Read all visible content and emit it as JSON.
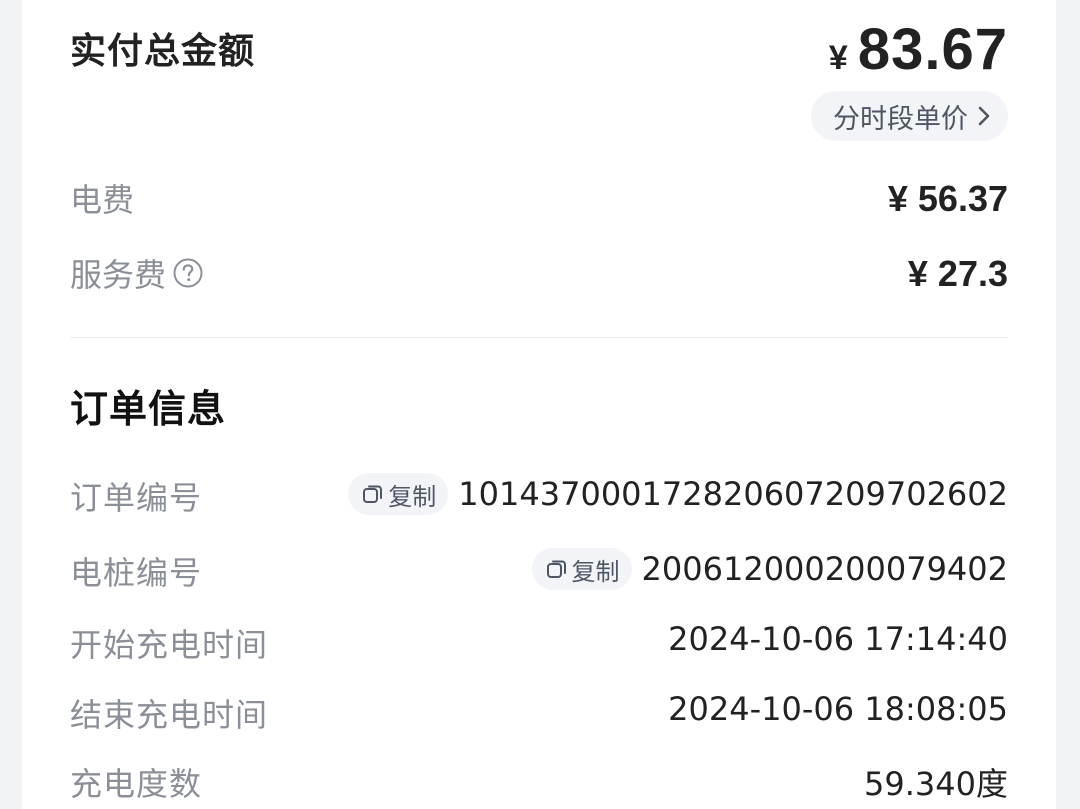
{
  "payment": {
    "total_label": "实付总金额",
    "currency": "¥",
    "total_value": "83.67",
    "tou_button_label": "分时段单价",
    "fees": [
      {
        "label": "电费",
        "value": "¥ 56.37"
      },
      {
        "label": "服务费",
        "value": "¥ 27.3",
        "help": true
      }
    ]
  },
  "order_info": {
    "title": "订单信息",
    "copy_label": "复制",
    "rows": [
      {
        "label": "订单编号",
        "value": "101437000172820607209702602",
        "copyable": true
      },
      {
        "label": "电桩编号",
        "value": "200612000200079402",
        "copyable": true
      },
      {
        "label": "开始充电时间",
        "value": "2024-10-06 17:14:40"
      },
      {
        "label": "结束充电时间",
        "value": "2024-10-06 18:08:05"
      },
      {
        "label": "充电度数",
        "value": "59.340度"
      }
    ]
  },
  "icons": {
    "chevron": "chevron-right-icon",
    "help": "question-circle-icon",
    "copy": "copy-icon"
  }
}
